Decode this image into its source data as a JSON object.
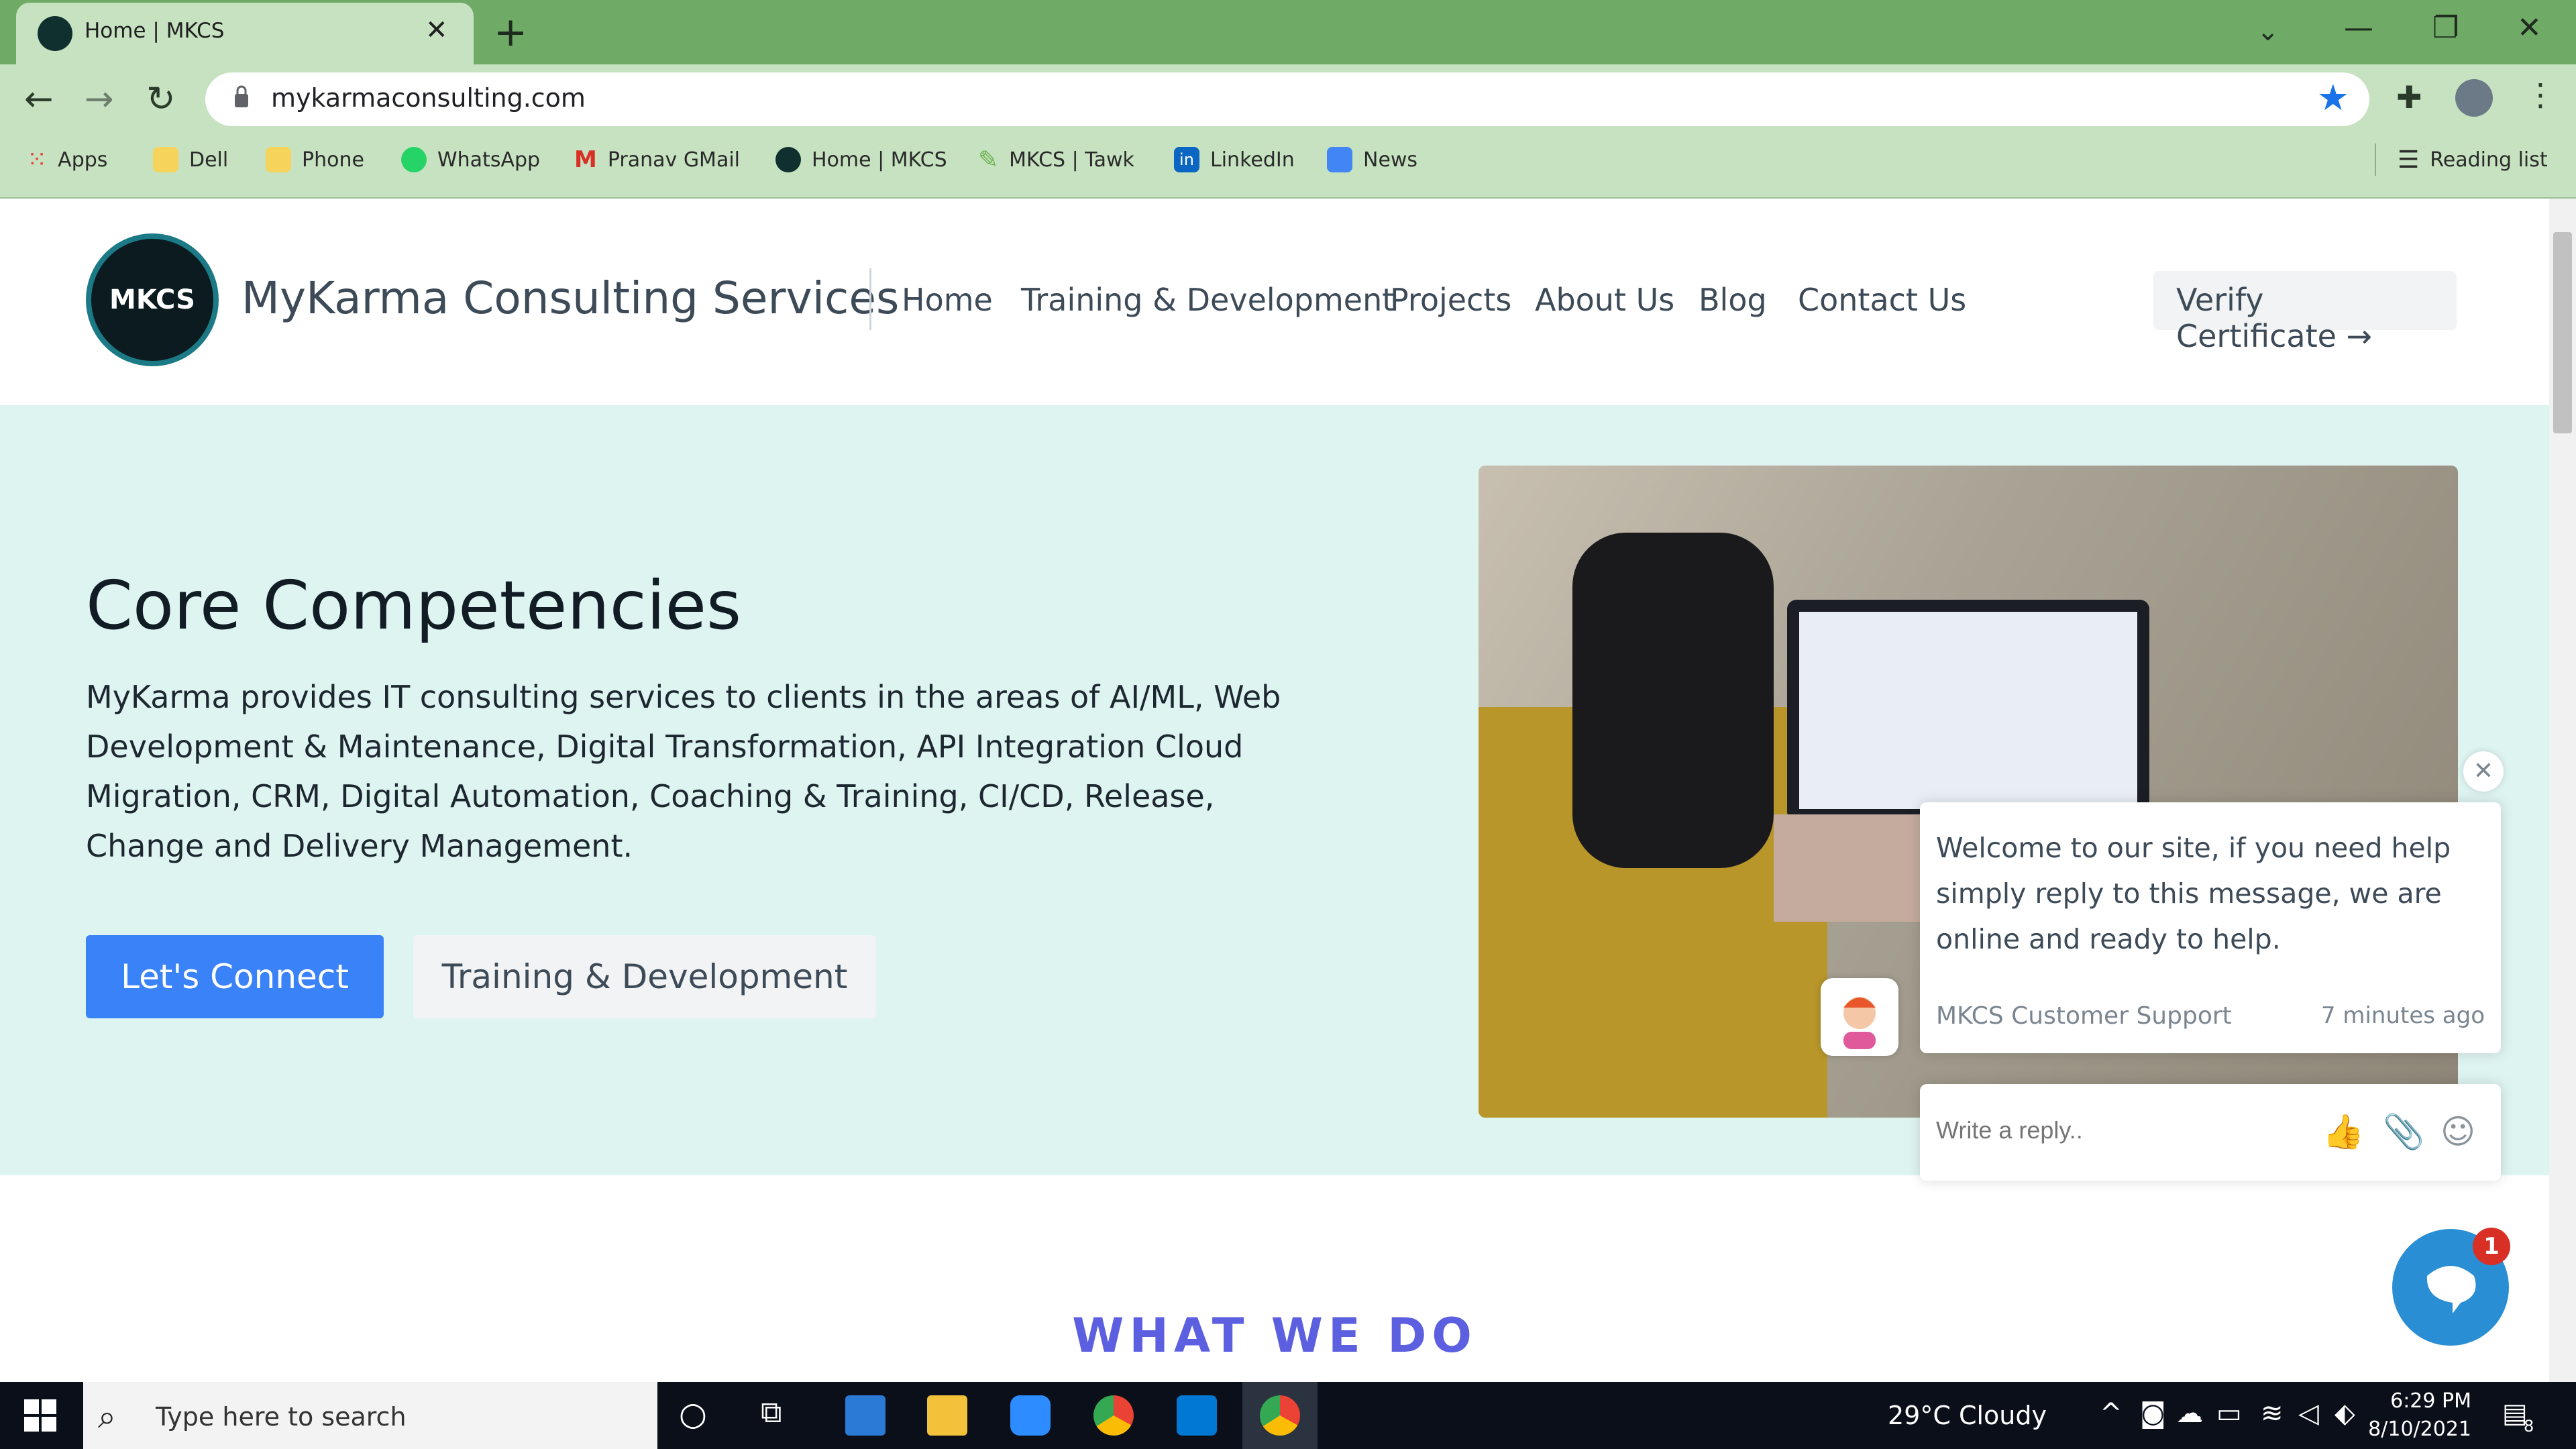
{
  "browser": {
    "tab_title": "Home | MKCS",
    "url": "mykarmaconsulting.com",
    "bookmarks": [
      "Apps",
      "Dell",
      "Phone",
      "WhatsApp",
      "Pranav GMail",
      "Home | MKCS",
      "MKCS | Tawk",
      "LinkedIn",
      "News"
    ],
    "reading_list": "Reading list"
  },
  "site": {
    "logo_text": "MKCS",
    "brand": "MyKarma Consulting Services",
    "nav": [
      "Home",
      "Training & Development",
      "Projects",
      "About Us",
      "Blog",
      "Contact Us"
    ],
    "verify": "Verify Certificate →",
    "hero_title": "Core Competencies",
    "hero_text": "MyKarma provides IT consulting services to clients in the areas of AI/ML, Web Development & Maintenance, Digital Transformation, API Integration Cloud Migration, CRM, Digital Automation, Coaching & Training, CI/CD, Release, Change and Delivery Management.",
    "btn_connect": "Let's Connect",
    "btn_training": "Training & Development",
    "section_title": "WHAT WE DO"
  },
  "chat": {
    "message": "Welcome to our site, if you need help simply reply to this message, we are online and ready to help.",
    "from": "MKCS Customer Support",
    "time": "7 minutes ago",
    "reply_placeholder": "Write a reply..",
    "unread": "1"
  },
  "taskbar": {
    "search_placeholder": "Type here to search",
    "weather": "29°C  Cloudy",
    "time": "6:29 PM",
    "date": "8/10/2021",
    "notifications": "8"
  }
}
